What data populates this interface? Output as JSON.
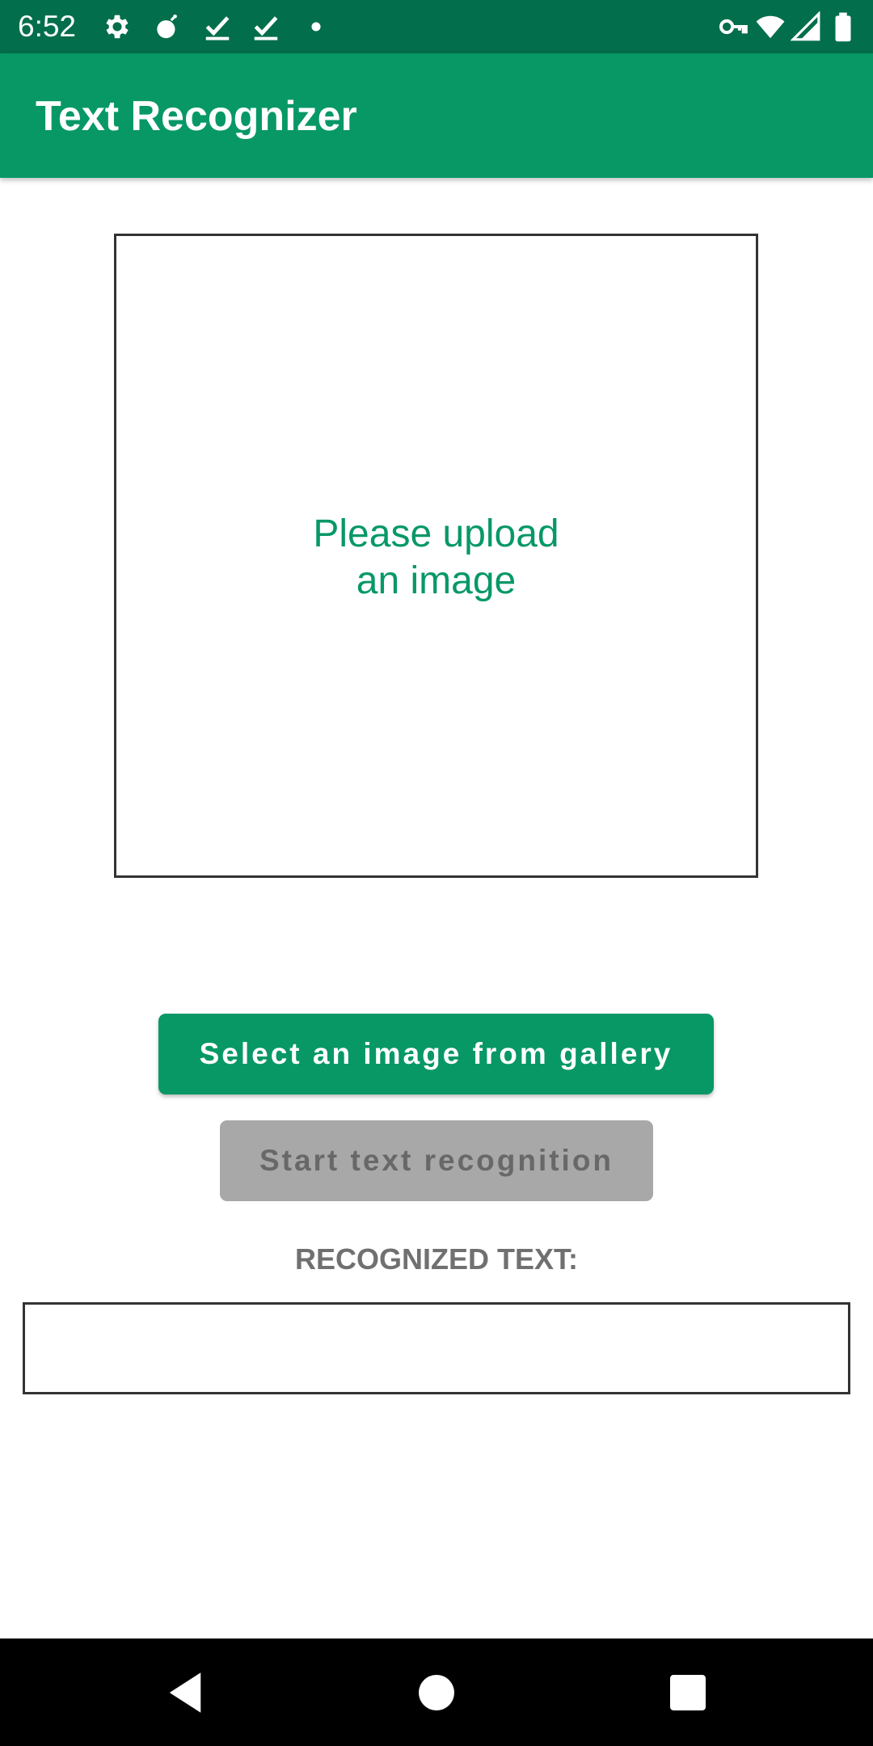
{
  "status_bar": {
    "time": "6:52",
    "left_icons": [
      "settings-icon",
      "bomb-icon",
      "download-done-icon",
      "download-done-icon",
      "dot-icon"
    ],
    "right_icons": [
      "vpn-key-icon",
      "wifi-icon",
      "cell-signal-icon",
      "battery-icon"
    ],
    "background": "#036e4b"
  },
  "app_bar": {
    "title": "Text Recognizer",
    "background": "#079866"
  },
  "image_box": {
    "placeholder_line1": "Please upload",
    "placeholder_line2": "an image"
  },
  "buttons": {
    "gallery_label": "Select an image from gallery",
    "recognize_label": "Start text recognition"
  },
  "recognized": {
    "label": "RECOGNIZED TEXT:",
    "value": ""
  },
  "nav_bar": {
    "icons": [
      "back-icon",
      "home-icon",
      "recents-icon"
    ]
  },
  "colors": {
    "accent": "#079866",
    "disabled_button": "#a8a8a8",
    "disabled_text": "#686868",
    "label_gray": "#707070"
  }
}
